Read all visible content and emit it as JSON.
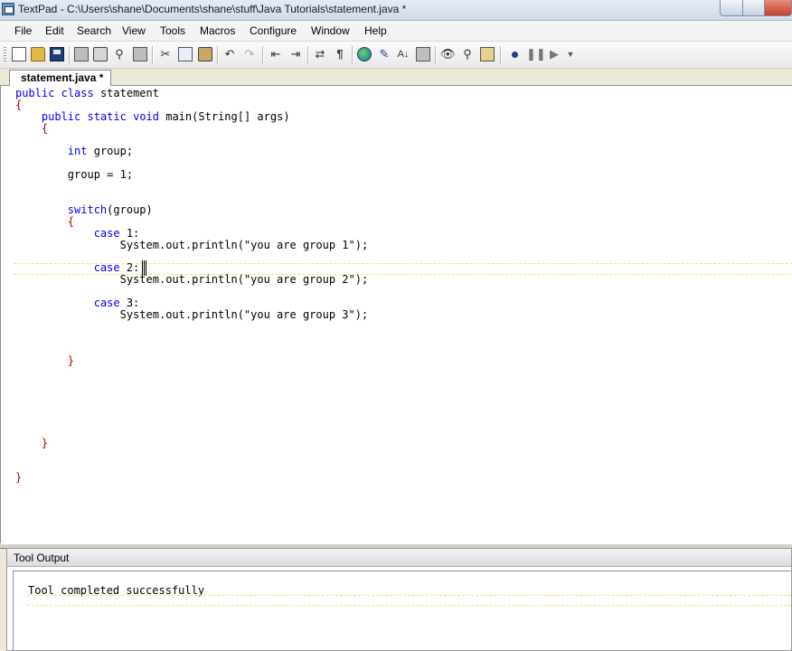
{
  "window": {
    "title": "TextPad - C:\\Users\\shane\\Documents\\shane\\stuff\\Java Tutorials\\statement.java *"
  },
  "menu": [
    "File",
    "Edit",
    "Search",
    "View",
    "Tools",
    "Macros",
    "Configure",
    "Window",
    "Help"
  ],
  "toolbar": {
    "icons": [
      "new-document-icon",
      "open-folder-icon",
      "save-icon",
      "save-all-icon",
      "print-icon",
      "print-preview-icon",
      "manage-files-icon",
      "cut-icon",
      "copy-icon",
      "paste-icon",
      "undo-icon",
      "redo-icon",
      "indent-icon",
      "word-wrap-icon",
      "pilcrow-icon",
      "web-browser-icon",
      "sort-icon",
      "insert-icon",
      "spell-check-icon",
      "find-icon",
      "find-in-files-icon",
      "clip-library-icon",
      "record-macro-icon",
      "pause-macro-icon",
      "play-macro-icon"
    ]
  },
  "tab": {
    "label": "statement.java *"
  },
  "editor": {
    "lines": [
      "public class statement",
      "{",
      "    public static void main(String[] args)",
      "    {",
      "",
      "        int group;",
      "",
      "        group = 1;",
      "",
      "",
      "        switch(group)",
      "        {",
      "            case 1:",
      "                System.out.println(\"you are group 1\");",
      "",
      "            case 2:",
      "                System.out.println(\"you are group 2\");",
      "",
      "            case 3:",
      "                System.out.println(\"you are group 3\");",
      "",
      "",
      "",
      "        }",
      "",
      "",
      "",
      "",
      "",
      "",
      "    }",
      "",
      "",
      "}"
    ]
  },
  "tool_output": {
    "title": "Tool Output",
    "message": "Tool completed successfully"
  },
  "colors": {
    "keyword": "#0000ff",
    "brace": "#b00000",
    "current_line": "#f0e27a"
  }
}
